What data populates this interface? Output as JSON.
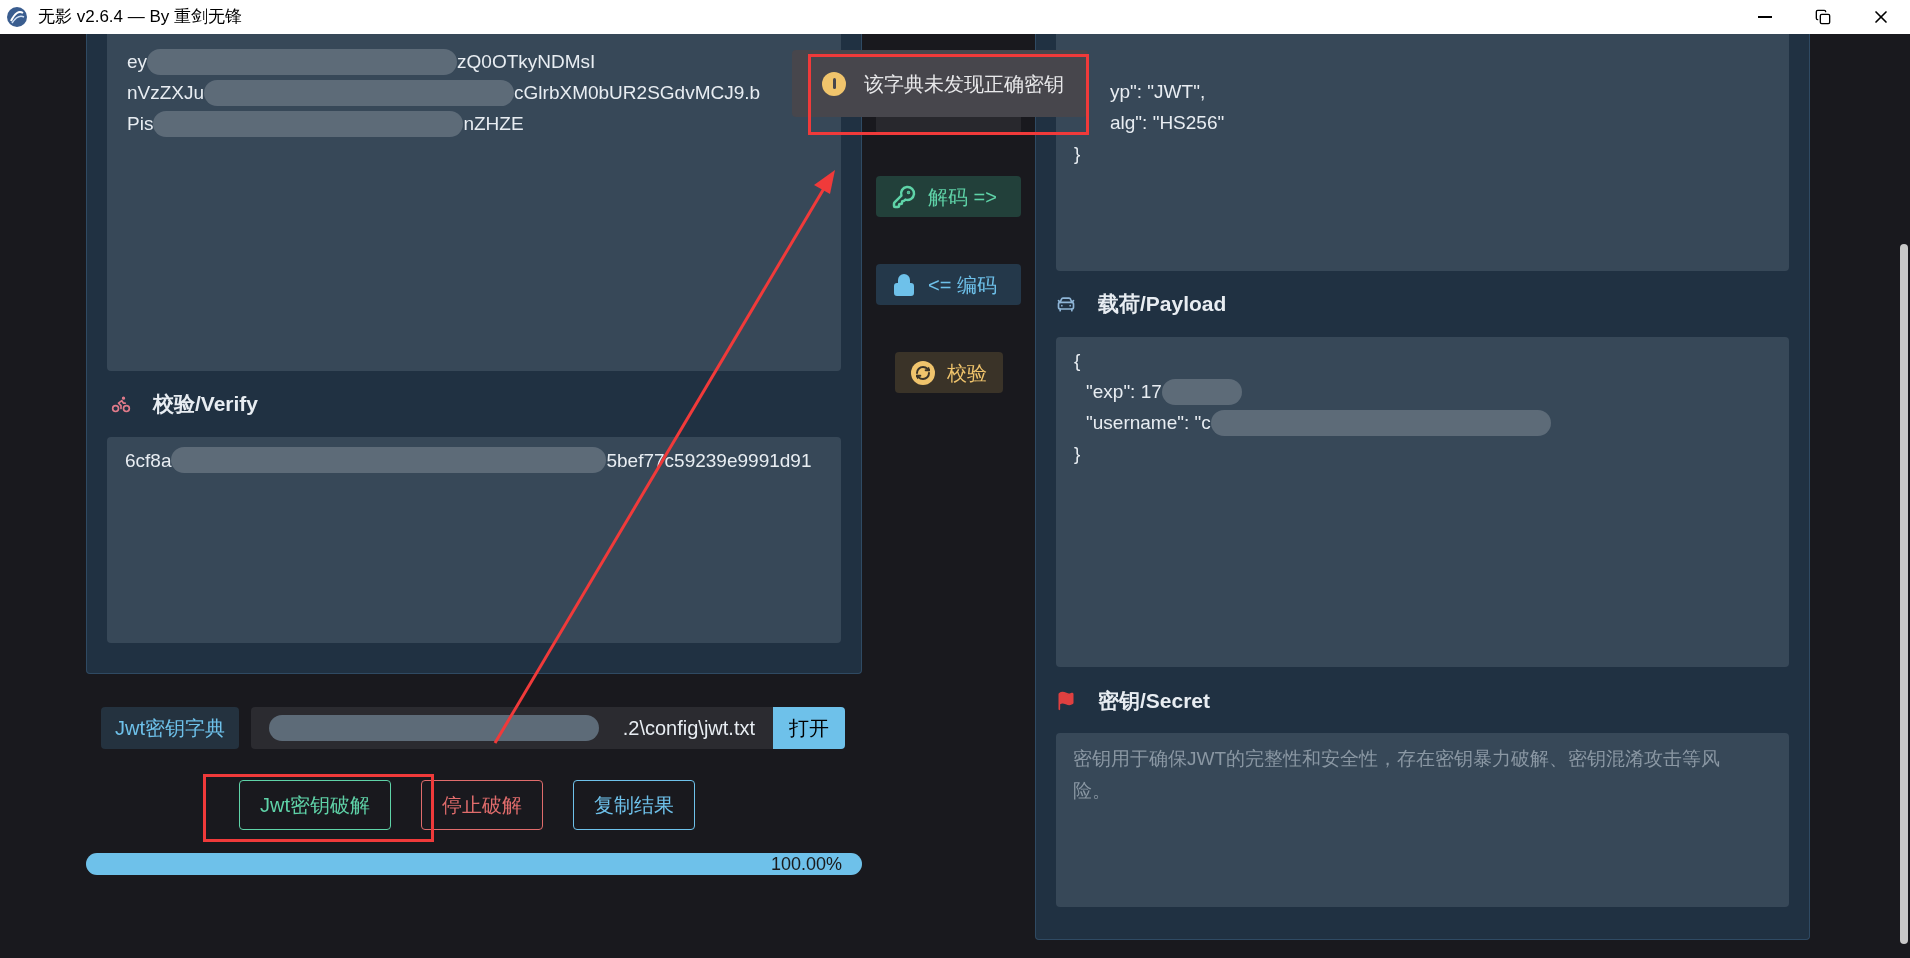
{
  "window": {
    "title": "无影 v2.6.4 — By 重剑无锋"
  },
  "token_field": {
    "lines": [
      {
        "start": "ey",
        "end": "zQ0OTkyNDMsI"
      },
      {
        "start": "nVzZXJu",
        "end": "cGlrbXM0bUR2SGdvMCJ9.b"
      },
      {
        "start": "Pis",
        "end": "nZHZE"
      }
    ]
  },
  "verify": {
    "heading": "校验/Verify",
    "start": "6cf8a",
    "end": "5bef77c59239e9991d91"
  },
  "actions": [
    {
      "label": "解码 =>",
      "kind": "decode"
    },
    {
      "label": "<= 编码",
      "kind": "encode"
    },
    {
      "label": "校验",
      "kind": "verify"
    }
  ],
  "header_field": {
    "lines": [
      "yp\": \"JWT\",",
      "alg\": \"HS256\"",
      "}"
    ]
  },
  "payload": {
    "heading": "载荷/Payload",
    "lines": [
      {
        "text": "{",
        "redacted": false
      },
      {
        "text": "\"exp\": 17",
        "redacted": true
      },
      {
        "text": "\"username\": \"c",
        "redacted": true
      },
      {
        "text": "}",
        "redacted": false
      }
    ]
  },
  "secret": {
    "heading": "密钥/Secret",
    "placeholder": "密钥用于确保JWT的完整性和安全性，存在密钥暴力破解、密钥混淆攻击等风险。"
  },
  "dictionary": {
    "label": "Jwt密钥字典",
    "path_end": ".2\\config\\jwt.txt",
    "open_button": "打开"
  },
  "buttons": [
    {
      "label": "Jwt密钥破解",
      "kind": "start"
    },
    {
      "label": "停止破解",
      "kind": "stop"
    },
    {
      "label": "复制结果",
      "kind": "copy"
    }
  ],
  "progress": {
    "level": 1,
    "reading": "100.00%"
  },
  "toast": {
    "message": "该字典未发现正确密钥",
    "kind": "warning"
  }
}
